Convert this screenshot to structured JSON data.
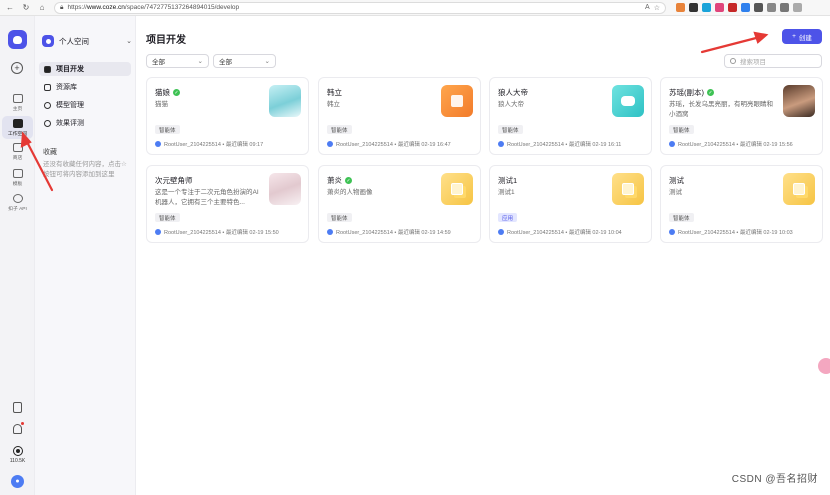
{
  "browser": {
    "url_prefix": "https://",
    "url_host": "www.coze.cn",
    "url_path": "/space/7472775137264894015/develop"
  },
  "rail": {
    "items": [
      {
        "label": "主页"
      },
      {
        "label": "工作空间"
      },
      {
        "label": "商店"
      },
      {
        "label": "模板"
      },
      {
        "label": "扣子 API"
      }
    ],
    "count": "110.5K"
  },
  "side": {
    "space_name": "个人空间",
    "menu": [
      {
        "label": "项目开发"
      },
      {
        "label": "资源库"
      },
      {
        "label": "模型管理"
      },
      {
        "label": "效果评测"
      }
    ],
    "favorites_title": "收藏",
    "favorites_empty": "还没有收藏任何内容，点击☆按钮可将内容添加到这里"
  },
  "main": {
    "title": "项目开发",
    "create_label": "创建",
    "filter1": "全部",
    "filter2": "全部",
    "search_placeholder": "搜索项目",
    "cards": [
      {
        "name": "猫娘",
        "desc": "猫猫",
        "tag": "智能体",
        "meta": "RootUser_2104225514 • 最近编辑 09:17"
      },
      {
        "name": "韩立",
        "desc": "韩立",
        "tag": "智能体",
        "meta": "RootUser_2104225514 • 最近编辑 02-19 16:47"
      },
      {
        "name": "狼人大帝",
        "desc": "狼人大帝",
        "tag": "智能体",
        "meta": "RootUser_2104225514 • 最近编辑 02-19 16:11"
      },
      {
        "name": "苏瑶(副本)",
        "desc": "苏瑶，长发乌黑亮丽，有明亮眼睛和小酒窝",
        "tag": "智能体",
        "meta": "RootUser_2104225514 • 最近编辑 02-19 15:56"
      },
      {
        "name": "次元壁角师",
        "desc": "这是一个专注于二次元角色扮演的AI机器人，它拥有三个主要特色...",
        "tag": "智能体",
        "meta": "RootUser_2104225514 • 最近编辑 02-19 15:50"
      },
      {
        "name": "萧炎",
        "desc": "萧炎的人物画像",
        "tag": "智能体",
        "meta": "RootUser_2104225514 • 最近编辑 02-19 14:59"
      },
      {
        "name": "测试1",
        "desc": "测试1",
        "tag": "应用",
        "meta": "RootUser_2104225514 • 最近编辑 02-19 10:04"
      },
      {
        "name": "测试",
        "desc": "测试",
        "tag": "智能体",
        "meta": "RootUser_2104225514 • 最近编辑 02-19 10:03"
      }
    ]
  },
  "watermark": "CSDN @吾名招财",
  "colors": {
    "accent": "#4d53e8",
    "arrow": "#e53935",
    "verified": "#3ec254"
  }
}
